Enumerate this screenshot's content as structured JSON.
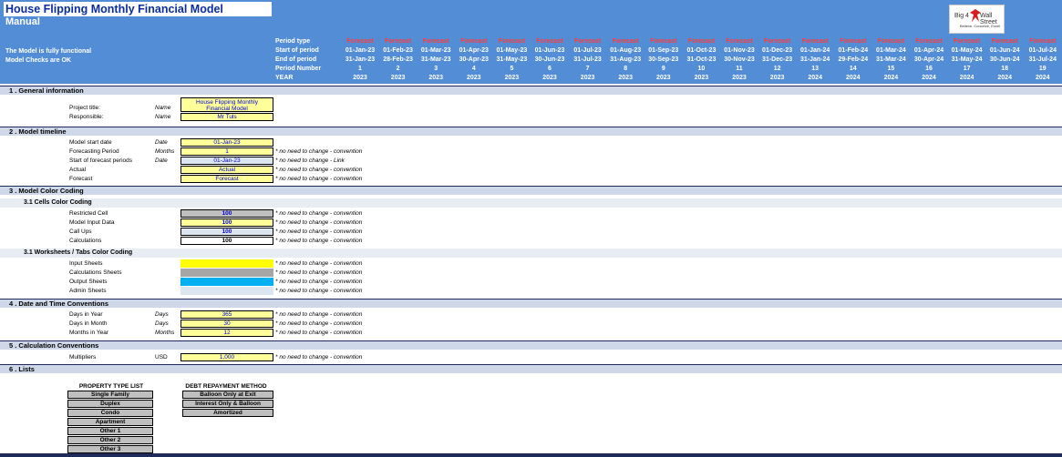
{
  "header": {
    "title": "House Flipping Monthly Financial Model",
    "subtitle": "Manual",
    "status1": "The Model is fully functional",
    "status2": "Model Checks are OK",
    "logo_text1": "Big 4",
    "logo_text2": "Wall Street",
    "logo_tagline": "Believe, Conceive, Excel",
    "row_labels": [
      "Period type",
      "Start of period",
      "End of period",
      "Period Number",
      "YEAR"
    ],
    "period_type": "Forecast",
    "starts": [
      "01-Jan-23",
      "01-Feb-23",
      "01-Mar-23",
      "01-Apr-23",
      "01-May-23",
      "01-Jun-23",
      "01-Jul-23",
      "01-Aug-23",
      "01-Sep-23",
      "01-Oct-23",
      "01-Nov-23",
      "01-Dec-23",
      "01-Jan-24",
      "01-Feb-24",
      "01-Mar-24",
      "01-Apr-24",
      "01-May-24",
      "01-Jun-24",
      "01-Jul-24"
    ],
    "ends": [
      "31-Jan-23",
      "28-Feb-23",
      "31-Mar-23",
      "30-Apr-23",
      "31-May-23",
      "30-Jun-23",
      "31-Jul-23",
      "31-Aug-23",
      "30-Sep-23",
      "31-Oct-23",
      "30-Nov-23",
      "31-Dec-23",
      "31-Jan-24",
      "29-Feb-24",
      "31-Mar-24",
      "30-Apr-24",
      "31-May-24",
      "30-Jun-24",
      "31-Jul-24"
    ],
    "numbers": [
      "1",
      "2",
      "3",
      "4",
      "5",
      "6",
      "7",
      "8",
      "9",
      "10",
      "11",
      "12",
      "13",
      "14",
      "15",
      "16",
      "17",
      "18",
      "19"
    ],
    "years": [
      "2023",
      "2023",
      "2023",
      "2023",
      "2023",
      "2023",
      "2023",
      "2023",
      "2023",
      "2023",
      "2023",
      "2023",
      "2024",
      "2024",
      "2024",
      "2024",
      "2024",
      "2024",
      "2024"
    ]
  },
  "sections": {
    "s1": "1 .  General information",
    "s2": "2 .  Model timeline",
    "s3": "3 .  Model Color Coding",
    "s3a": "3.1 Cells Color Coding",
    "s3b": "3.1 Worksheets / Tabs Color Coding",
    "s4": "4 .  Date and Time Conventions",
    "s5": "5 .  Calculation Conventions",
    "s6": "6 .  Lists"
  },
  "general": {
    "project_label": "Project title:",
    "project_unit": "Name",
    "project_value1": "House Flipping Monthly",
    "project_value2": "Financial Model",
    "resp_label": "Responsible:",
    "resp_unit": "Name",
    "resp_value": "Mr Tuls"
  },
  "timeline": [
    {
      "label": "Model start date",
      "unit": "Date",
      "value": "01-Jan-23",
      "note": ""
    },
    {
      "label": "Forecasting Period",
      "unit": "Months",
      "value": "1",
      "note": "* no need to change - convention"
    },
    {
      "label": "Start of forecast periods",
      "unit": "Date",
      "value": "01-Jan-23",
      "note": "* no need to change - Link"
    },
    {
      "label": "Actual",
      "unit": "",
      "value": "Actual",
      "note": "* no need to change - convention"
    },
    {
      "label": "Forecast",
      "unit": "",
      "value": "Forecast",
      "note": "* no need to change - convention"
    }
  ],
  "cells": [
    {
      "label": "Restricted Cell",
      "value": "100",
      "note": "* no need to change - convention",
      "color": "#bfbfbf"
    },
    {
      "label": "Model Input Data",
      "value": "100",
      "note": "* no need to change - convention",
      "color": "#ffff99"
    },
    {
      "label": "Call Ups",
      "value": "100",
      "note": "* no need to change - convention",
      "color": "#dce6f1"
    },
    {
      "label": "Calculations",
      "value": "100",
      "note": "* no need to change - convention",
      "color": "#ffffff"
    }
  ],
  "sheets": [
    {
      "label": "Input Sheets",
      "note": "* no need to change - convention",
      "color": "#ffff00"
    },
    {
      "label": "Calculations Sheets",
      "note": "* no need to change - convention",
      "color": "#a6a6a6"
    },
    {
      "label": "Output Sheets",
      "note": "* no need to change - convention",
      "color": "#00b0f0"
    },
    {
      "label": "Admin Sheets",
      "note": "* no need to change - convention",
      "color": "#dce6f1"
    }
  ],
  "datetime": [
    {
      "label": "Days in Year",
      "unit": "Days",
      "value": "365",
      "note": "* no need to change - convention"
    },
    {
      "label": "Days in Month",
      "unit": "Days",
      "value": "30",
      "note": "* no need to change - convention"
    },
    {
      "label": "Months in Year",
      "unit": "Months",
      "value": "12",
      "note": "* no need to change - convention"
    }
  ],
  "calc": {
    "label": "Multipliers",
    "unit": "USD",
    "value": "1,000",
    "note": "* no need to change - convention"
  },
  "lists": {
    "property_header": "PROPERTY TYPE LIST",
    "property": [
      "Single Family",
      "Duplex",
      "Condo",
      "Apartment",
      "Other 1",
      "Other 2",
      "Other 3"
    ],
    "debt_header": "DEBT REPAYMENT METHOD",
    "debt": [
      "Balloon Only at Exit",
      "Interest Only & Balloon",
      "Amortized"
    ]
  }
}
